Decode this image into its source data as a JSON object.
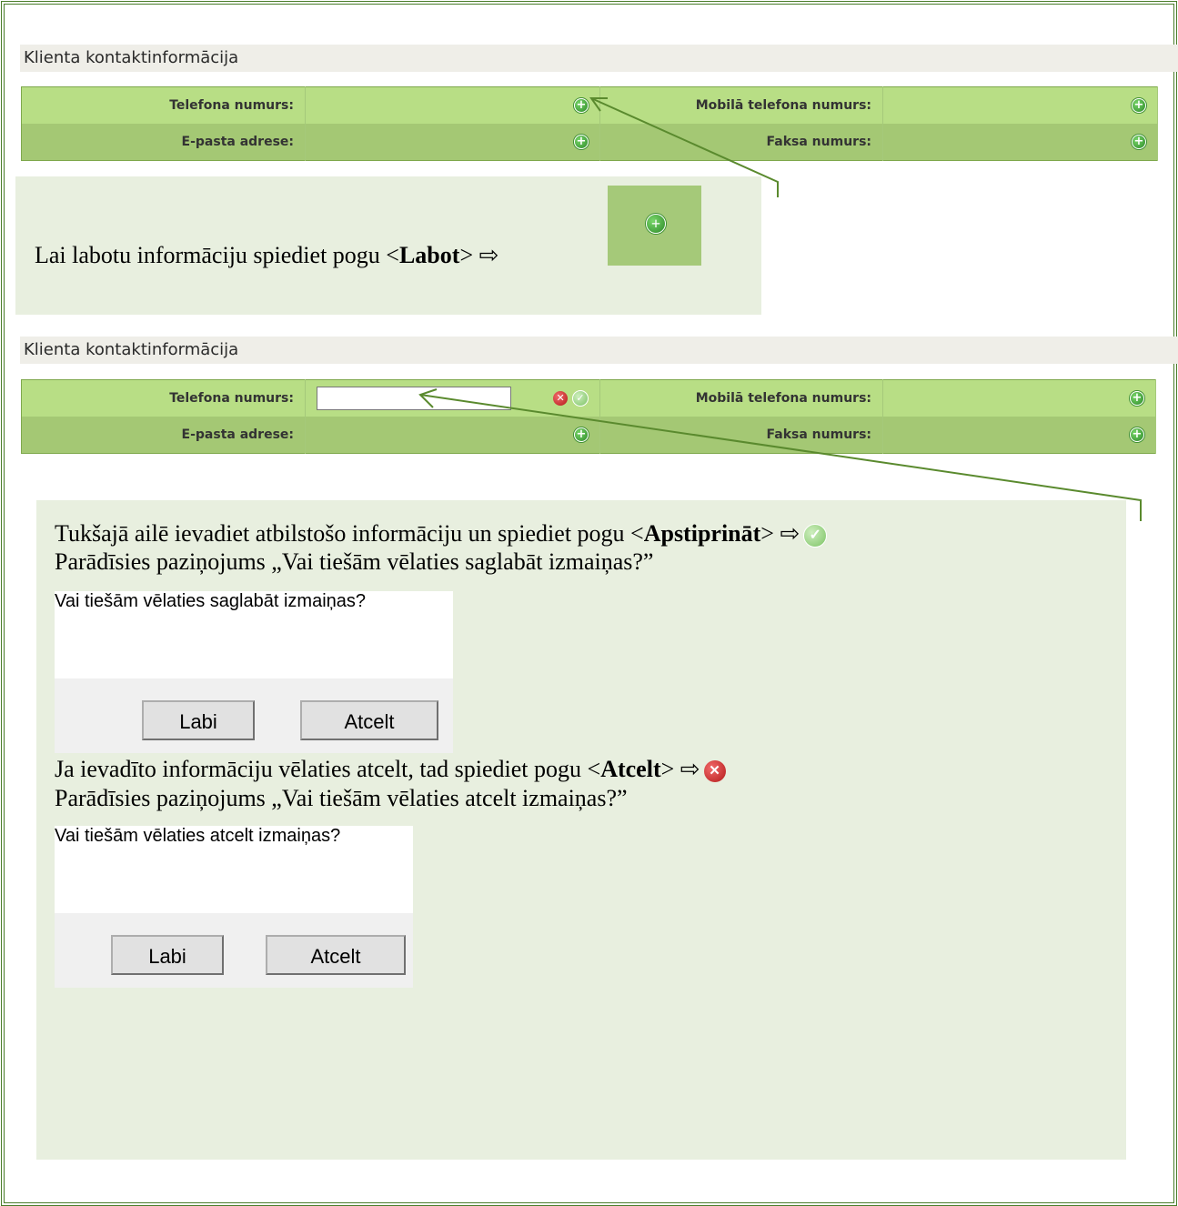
{
  "panel1": {
    "title": "Klienta kontaktinformācija",
    "rows": [
      {
        "label1": "Telefona numurs:",
        "label2": "Mobilā telefona numurs:"
      },
      {
        "label1": "E-pasta adrese:",
        "label2": "Faksa numurs:"
      }
    ]
  },
  "note1": {
    "text_pre": "Lai labotu informāciju spiediet pogu <",
    "bold": "Labot",
    "text_post": "> ⇨"
  },
  "panel2": {
    "title": "Klienta kontaktinformācija",
    "rows": [
      {
        "label1": "Telefona numurs:",
        "label2": "Mobilā telefona numurs:"
      },
      {
        "label1": "E-pasta adrese:",
        "label2": "Faksa numurs:"
      }
    ],
    "input_value": ""
  },
  "note2": {
    "line1_pre": "Tukšajā ailē ievadiet atbilstošo informāciju un spiediet pogu <",
    "line1_bold": "Apstiprināt",
    "line1_post": "> ⇨",
    "line2": "Parādīsies paziņojums „Vai tiešām vēlaties saglabāt izmaiņas?”",
    "dialog1": {
      "message": "Vai tiešām vēlaties saglabāt izmaiņas?",
      "ok": "Labi",
      "cancel": "Atcelt"
    },
    "line3_pre": "Ja ievadīto informāciju vēlaties atcelt, tad spiediet pogu <",
    "line3_bold": "Atcelt",
    "line3_post": "> ⇨",
    "line4": "Parādīsies paziņojums „Vai tiešām vēlaties atcelt izmaiņas?”",
    "dialog2": {
      "message": "Vai tiešām vēlaties atcelt izmaiņas?",
      "ok": "Labi",
      "cancel": "Atcelt"
    }
  },
  "icons": {
    "add": "plus-circle-icon",
    "confirm": "check-circle-icon",
    "cancel": "x-circle-icon"
  },
  "colors": {
    "row_light": "#b8de85",
    "row_dark": "#a4c874",
    "note_bg": "#e8efdf",
    "border": "#4a7d2a"
  }
}
